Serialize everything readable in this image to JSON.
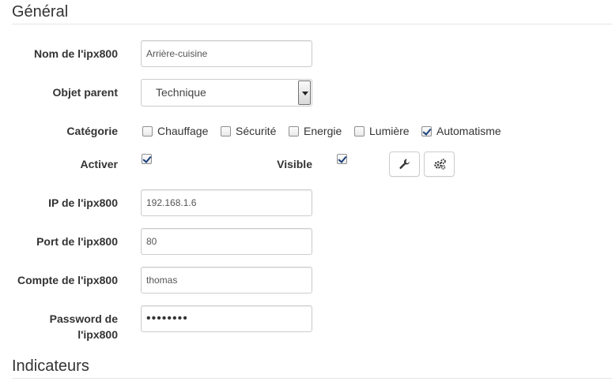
{
  "sections": {
    "general": "Général",
    "indicators": "Indicateurs"
  },
  "fields": {
    "name": {
      "label": "Nom de l'ipx800",
      "value": "Arrière-cuisine"
    },
    "parent": {
      "label": "Objet parent",
      "value": "Technique"
    },
    "category": {
      "label": "Catégorie",
      "options": [
        {
          "label": "Chauffage",
          "checked": false
        },
        {
          "label": "Sécurité",
          "checked": false
        },
        {
          "label": "Energie",
          "checked": false
        },
        {
          "label": "Lumière",
          "checked": false
        },
        {
          "label": "Automatisme",
          "checked": true
        }
      ]
    },
    "activate": {
      "label": "Activer",
      "checked": true
    },
    "visible": {
      "label": "Visible",
      "checked": true
    },
    "ip": {
      "label": "IP de l'ipx800",
      "value": "192.168.1.6"
    },
    "port": {
      "label": "Port de l'ipx800",
      "value": "80"
    },
    "account": {
      "label": "Compte de l'ipx800",
      "value": "thomas"
    },
    "password": {
      "label_line1": "Password de",
      "label_line2": "l'ipx800",
      "value": "••••••••"
    }
  },
  "icons": {
    "configure": "wrench-icon",
    "advanced": "gears-icon"
  }
}
